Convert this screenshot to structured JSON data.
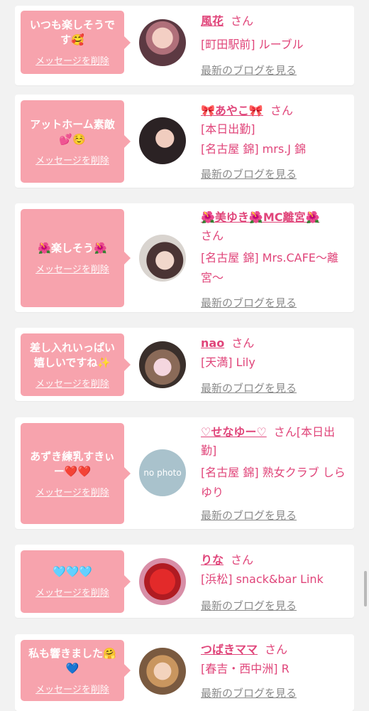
{
  "delete_label": "メッセージを削除",
  "blog_label": "最新のブログを見る",
  "san": "さん",
  "cards": [
    {
      "message": "いつも楽しそうです🥰",
      "name": "風花",
      "shop": "[町田駅前] ルーブル",
      "avatar": "woman-photo"
    },
    {
      "message": "アットホーム素敵💕☺️",
      "name": "🎀あやこ🎀",
      "status": "[本日出勤]",
      "shop": "[名古屋 錦] mrs.J 錦",
      "avatar": "woman-photo"
    },
    {
      "message": "🌺楽しそう🌺",
      "name": "🌺美ゆき🌺MC離宮🌺",
      "shop": "[名古屋 錦] Mrs.CAFE〜離宮〜",
      "avatar": "woman-photo"
    },
    {
      "message": "差し入れいっぱい嬉しいですね✨",
      "name": "nao",
      "shop": "[天満] Lily",
      "avatar": "bar-photo"
    },
    {
      "message": "あずき練乳すきぃー❤️❤️",
      "name": "♡せなゆー♡",
      "status": "[本日出勤]",
      "shop": "[名古屋 錦] 熟女クラブ しらゆり",
      "avatar": "no-photo",
      "avatar_text": "no photo"
    },
    {
      "message": "🩵🩵🩵",
      "name": "りな",
      "shop": "[浜松] snack&bar Link",
      "avatar": "heart-photo"
    },
    {
      "message": "私も響きました🤗💙",
      "name": "つばきママ",
      "shop": "[春吉・西中洲] R",
      "avatar": "woman-photo"
    }
  ],
  "colors": {
    "accent": "#e0457a",
    "bubble": "#f7a3ad",
    "background": "#f2f2f2",
    "link_gray": "#8a8a8a"
  }
}
